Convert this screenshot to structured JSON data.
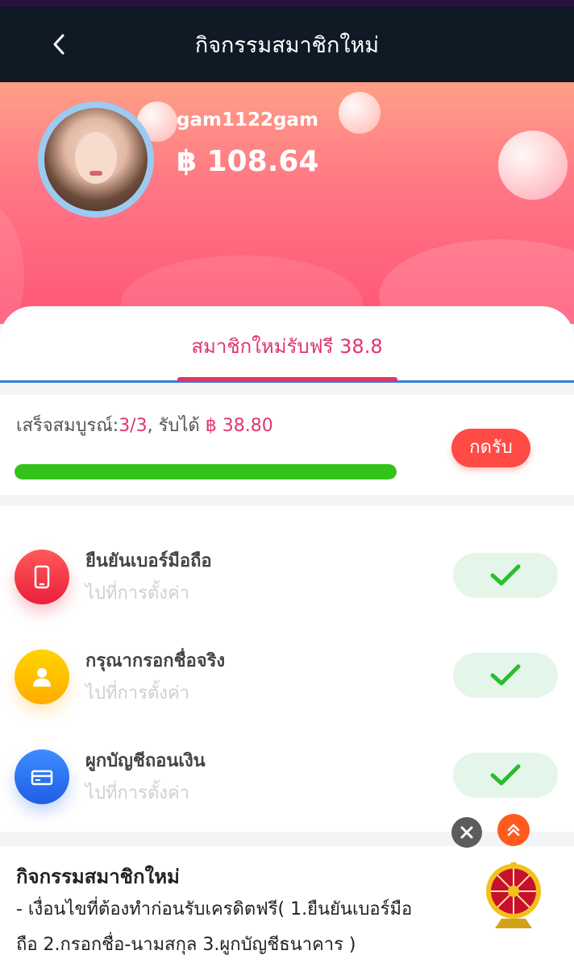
{
  "nav": {
    "title": "กิจกรรมสมาชิกใหม่"
  },
  "profile": {
    "username": "gam1122gam",
    "balance": "฿ 108.64"
  },
  "tab": {
    "label": "สมาชิกใหม่รับฟรี 38.8"
  },
  "progress": {
    "label_prefix": "เสร็จสมบูรณ์:",
    "count": "3/3",
    "label_mid": ", รับได้ ",
    "amount": "฿ 38.80",
    "fraction": 1.0,
    "claim_label": "กดรับ"
  },
  "tasks": [
    {
      "title": "ยืนยันเบอร์มือถือ",
      "subtitle": "ไปที่การตั้งค่า",
      "icon": "phone-icon",
      "done": true
    },
    {
      "title": "กรุณากรอกชื่อจริง",
      "subtitle": "ไปที่การตั้งค่า",
      "icon": "user-icon",
      "done": true
    },
    {
      "title": "ผูกบัญชีถอนเงิน",
      "subtitle": "ไปที่การตั้งค่า",
      "icon": "card-icon",
      "done": true
    }
  ],
  "description": {
    "title": "กิจกรรมสมาชิกใหม่",
    "line1": "- เงื่อนไขที่ต้องทำก่อนรับเครดิตฟรี( 1.ยืนยันเบอร์มือ",
    "line2": "ถือ  2.กรอกชื่อ-นามสกุล  3.ผูกบัญชีธนาคาร )"
  },
  "colors": {
    "accent": "#e0356e",
    "progress": "#33c318",
    "claim": "#ff4a45",
    "navbar": "#0f1a24"
  }
}
